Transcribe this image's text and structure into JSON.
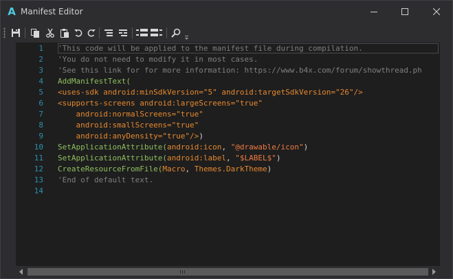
{
  "window": {
    "title": "Manifest Editor",
    "app_icon_letter": "A",
    "accent_color": "#4ec9e0",
    "controls": [
      "minimize-icon",
      "maximize-icon",
      "close-icon"
    ]
  },
  "toolbar": {
    "icons": [
      "save-icon",
      "copy-icon",
      "cut-icon",
      "paste-icon",
      "undo-icon",
      "redo-icon",
      "comment-block-icon",
      "uncomment-block-icon",
      "indent-icon",
      "outdent-icon",
      "find-icon",
      "more-options-icon"
    ]
  },
  "editor": {
    "lines": [
      {
        "n": "1",
        "segments": [
          {
            "t": "'This code will be applied to the manifest file during compilation.",
            "c": "com"
          }
        ]
      },
      {
        "n": "2",
        "segments": [
          {
            "t": "'You do not need to modify it in most cases.",
            "c": "com"
          }
        ]
      },
      {
        "n": "3",
        "segments": [
          {
            "t": "'See this link for for more information: https://www.b4x.com/forum/showthread.ph",
            "c": "com"
          }
        ]
      },
      {
        "n": "4",
        "segments": [
          {
            "t": "AddManifestText(",
            "c": "fn"
          }
        ]
      },
      {
        "n": "5",
        "segments": [
          {
            "t": "<uses-sdk android:minSdkVersion=\"5\" android:targetSdkVersion=\"26\"/>",
            "c": "tag"
          }
        ]
      },
      {
        "n": "6",
        "segments": [
          {
            "t": "<supports-screens android:largeScreens=\"true\"",
            "c": "tag"
          }
        ]
      },
      {
        "n": "7",
        "segments": [
          {
            "t": "    android:normalScreens=\"true\"",
            "c": "tag"
          }
        ]
      },
      {
        "n": "8",
        "segments": [
          {
            "t": "    android:smallScreens=\"true\"",
            "c": "tag"
          }
        ]
      },
      {
        "n": "9",
        "segments": [
          {
            "t": "    android:anyDensity=\"true\"/>",
            "c": "tag"
          },
          {
            "t": ")",
            "c": "pun"
          }
        ]
      },
      {
        "n": "10",
        "segments": [
          {
            "t": "SetApplicationAttribute(",
            "c": "fn"
          },
          {
            "t": "android:icon",
            "c": "tag"
          },
          {
            "t": ", ",
            "c": "pun"
          },
          {
            "t": "\"@drawable/icon\"",
            "c": "str"
          },
          {
            "t": ")",
            "c": "pun"
          }
        ]
      },
      {
        "n": "11",
        "segments": [
          {
            "t": "SetApplicationAttribute(",
            "c": "fn"
          },
          {
            "t": "android:label",
            "c": "tag"
          },
          {
            "t": ", ",
            "c": "pun"
          },
          {
            "t": "\"$LABEL$\"",
            "c": "str"
          },
          {
            "t": ")",
            "c": "pun"
          }
        ]
      },
      {
        "n": "12",
        "segments": [
          {
            "t": "CreateResourceFromFile(",
            "c": "fn"
          },
          {
            "t": "Macro",
            "c": "tag"
          },
          {
            "t": ", ",
            "c": "pun"
          },
          {
            "t": "Themes.DarkTheme",
            "c": "tag"
          },
          {
            "t": ")",
            "c": "pun"
          }
        ]
      },
      {
        "n": "13",
        "segments": [
          {
            "t": "'End of default text.",
            "c": "com"
          }
        ]
      },
      {
        "n": "14",
        "segments": []
      }
    ]
  }
}
